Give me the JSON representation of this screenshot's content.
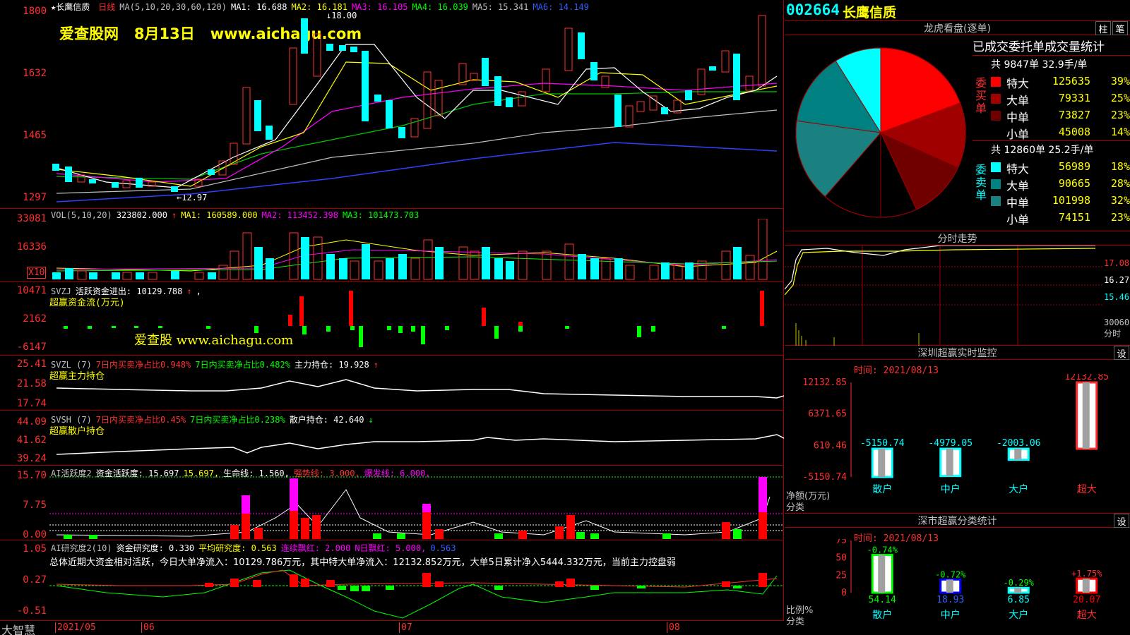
{
  "main_chart": {
    "title_stock": "长鹰信质",
    "period": "日线",
    "ma_label": "MA(5,10,20,30,60,120)",
    "ma1": "MA1: 16.688",
    "ma2": "MA2: 16.181",
    "ma3": "MA3: 16.105",
    "ma4": "MA4: 16.039",
    "ma5": "MA5: 15.341",
    "ma6": "MA6: 14.149",
    "watermark": "爱查股网   8月13日   www.aichagu.com",
    "high_mark": "18.00",
    "low_mark": "12.97",
    "y_labels": [
      "1800",
      "1632",
      "1465",
      "1297"
    ]
  },
  "vol_panel": {
    "label": "VOL(5,10,20)",
    "vol": "323802.000",
    "ma1": "MA1: 160589.000",
    "ma2": "MA2: 113452.398",
    "ma3": "MA3: 101473.703",
    "y_labels": [
      "33081",
      "16336"
    ],
    "unit": "X10"
  },
  "svzj_panel": {
    "name": "SVZJ",
    "label": "活跃资金进出: 10129.788",
    "sub": "超赢资金流(万元)",
    "watermark": "爱查股 www.aichagu.com",
    "y_labels": [
      "10471",
      "2162",
      "-6147"
    ]
  },
  "svzl_panel": {
    "name": "SVZL (7)",
    "a": "7日内买卖净占比0.948%",
    "b": "7日内买卖净占比0.482%",
    "c": "主力持仓: 19.928",
    "sub": "超赢主力持仓",
    "y_labels": [
      "25.41",
      "21.58",
      "17.74"
    ]
  },
  "svsh_panel": {
    "name": "SVSH (7)",
    "a": "7日内买卖净占比0.45%",
    "b": "7日内买卖净占比0.238%",
    "c": "散户持仓: 42.640",
    "sub": "超赢散户持仓",
    "y_labels": [
      "44.09",
      "41.62",
      "39.24"
    ]
  },
  "ai_panel": {
    "name": "AI活跃度2",
    "a": "资金活跃度: 15.697",
    "b": "15.697,",
    "c": "生命线: 1.560,",
    "d": "强势线: 3.000,",
    "e": "爆发线: 6.000,",
    "y_labels": [
      "15.70",
      "7.75",
      "0.00"
    ]
  },
  "research_panel": {
    "name": "AI研究度2(10)",
    "a": "资金研究度: 0.330",
    "b": "平均研究度: 0.563",
    "c": "连续飘红: 2.000",
    "d": "N日飘红: 5.000,",
    "e": "0.563",
    "summary": "总体近期大资金相对活跃，今日大单净流入：10129.786万元，其中特大单净流入：12132.852万元，大单5日累计净入5444.332万元，当前主力控盘弱",
    "y_labels": [
      "1.05",
      "0.27",
      "-0.51"
    ]
  },
  "bottom_bar": {
    "brand": "大智慧",
    "dates": [
      "2021/05",
      "06",
      "07",
      "08"
    ]
  },
  "right_panel": {
    "code": "002664",
    "name": "长鹰信质",
    "longhu": {
      "title": "龙虎看盘(逐单)",
      "btn1": "柱",
      "btn2": "笔",
      "stat_title": "已成交委托单成交量统计",
      "buy_label": "委买单",
      "sell_label": "委卖单",
      "buy_total": "共 9847单 32.9手/单",
      "sell_total": "共 12860单 25.2手/单",
      "buy_rows": [
        {
          "name": "特大",
          "vol": "125635",
          "pct": "39%",
          "color": "#ff0000"
        },
        {
          "name": "大单",
          "vol": "79331",
          "pct": "25%",
          "color": "#a00000"
        },
        {
          "name": "中单",
          "vol": "73827",
          "pct": "23%",
          "color": "#700000"
        },
        {
          "name": "小单",
          "vol": "45008",
          "pct": "14%",
          "color": "#000000"
        }
      ],
      "sell_rows": [
        {
          "name": "特大",
          "vol": "56989",
          "pct": "18%",
          "color": "#00ffff"
        },
        {
          "name": "大单",
          "vol": "90665",
          "pct": "28%",
          "color": "#008080"
        },
        {
          "name": "中单",
          "vol": "101998",
          "pct": "32%",
          "color": "#1a8080"
        },
        {
          "name": "小单",
          "vol": "74151",
          "pct": "23%",
          "color": "#000000"
        }
      ]
    },
    "intraday": {
      "title": "分时走势",
      "prices": [
        "17.08",
        "16.27",
        "15.46"
      ],
      "vol_label": "30060",
      "vol_unit": "分时"
    },
    "sz_monitor": {
      "title": "深圳超赢实时监控",
      "btn": "设",
      "time": "时间: 2021/08/13",
      "y_labels": [
        "12132.85",
        "6371.65",
        "610.46",
        "-5150.74"
      ],
      "unit": "净额(万元)",
      "cat_label": "分类"
    },
    "sz_stats": {
      "title": "深市超赢分类统计",
      "btn": "设",
      "time": "时间: 2021/08/13",
      "y_labels": [
        "75",
        "50",
        "25",
        "0"
      ],
      "unit": "比例%",
      "cat_label": "分类"
    }
  },
  "chart_data": [
    {
      "type": "bar",
      "title": "深圳超赢实时监控",
      "ylabel": "净额(万元)",
      "categories": [
        "散户",
        "中户",
        "大户",
        "超大"
      ],
      "values": [
        -5150.74,
        -4979.05,
        -2003.06,
        12132.85
      ],
      "value_labels": [
        "-5150.74",
        "-4979.05",
        "-2003.06",
        "12132.85"
      ],
      "ylim": [
        -5150.74,
        12132.85
      ]
    },
    {
      "type": "bar",
      "title": "深市超赢分类统计",
      "ylabel": "比例%",
      "categories": [
        "散户",
        "中户",
        "大户",
        "超大"
      ],
      "values": [
        54.14,
        18.93,
        6.85,
        20.07
      ],
      "value_labels": [
        "54.14",
        "18.93",
        "6.85",
        "20.07"
      ],
      "changes": [
        "-0.74%",
        "-0.72%",
        "-0.29%",
        "+1.75%"
      ],
      "ylim": [
        0,
        75
      ]
    },
    {
      "type": "pie",
      "title": "龙虎看盘(逐单)",
      "categories": [
        "买特大",
        "买大单",
        "买中单",
        "买小单",
        "卖小单",
        "卖中单",
        "卖大单",
        "卖特大"
      ],
      "values": [
        19.5,
        12.5,
        11.5,
        7,
        11.5,
        16,
        14,
        9
      ],
      "colors": [
        "#ff0000",
        "#a00000",
        "#700000",
        "#000000",
        "#000000",
        "#1a8080",
        "#008080",
        "#00ffff"
      ]
    }
  ]
}
